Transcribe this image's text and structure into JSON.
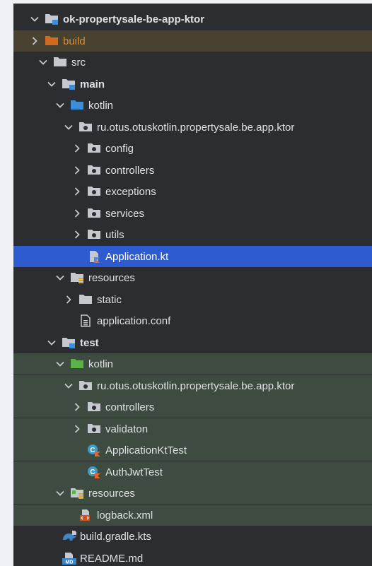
{
  "colors": {
    "panel_bg": "#2b2d30",
    "selection": "#2e5bd0",
    "excluded_bg": "#4a4230",
    "test_sources_bg": "#3d4b40",
    "folder_gray": "#c5c8ce",
    "folder_blue": "#3c8fd6",
    "folder_green": "#5bb246",
    "folder_orange": "#d06b1e",
    "excluded_text": "#d48f3c"
  },
  "tree": [
    {
      "label": "ok-propertysale-be-app-ktor",
      "icon": "module-folder-icon",
      "chevron": "down",
      "depth": 0,
      "bold": true
    },
    {
      "label": "build",
      "icon": "folder-excluded-icon",
      "chevron": "right",
      "depth": 0,
      "style": "excluded"
    },
    {
      "label": "src",
      "icon": "folder-icon",
      "chevron": "down",
      "depth": 1
    },
    {
      "label": "main",
      "icon": "module-folder-icon",
      "chevron": "down",
      "depth": 2,
      "bold": true
    },
    {
      "label": "kotlin",
      "icon": "folder-source-icon",
      "chevron": "down",
      "depth": 3
    },
    {
      "label": "ru.otus.otuskotlin.propertysale.be.app.ktor",
      "icon": "package-icon",
      "chevron": "down",
      "depth": 4
    },
    {
      "label": "config",
      "icon": "package-icon",
      "chevron": "right",
      "depth": 5
    },
    {
      "label": "controllers",
      "icon": "package-icon",
      "chevron": "right",
      "depth": 5
    },
    {
      "label": "exceptions",
      "icon": "package-icon",
      "chevron": "right",
      "depth": 5
    },
    {
      "label": "services",
      "icon": "package-icon",
      "chevron": "right",
      "depth": 5
    },
    {
      "label": "utils",
      "icon": "package-icon",
      "chevron": "right",
      "depth": 5
    },
    {
      "label": "Application.kt",
      "icon": "kotlin-file-icon",
      "chevron": "none",
      "depth": 5,
      "style": "selected"
    },
    {
      "label": "resources",
      "icon": "folder-resources-icon",
      "chevron": "down",
      "depth": 3
    },
    {
      "label": "static",
      "icon": "folder-icon",
      "chevron": "right",
      "depth": 4
    },
    {
      "label": "application.conf",
      "icon": "config-file-icon",
      "chevron": "none",
      "depth": 4
    },
    {
      "label": "test",
      "icon": "module-folder-icon",
      "chevron": "down",
      "depth": 2,
      "bold": true
    },
    {
      "label": "kotlin",
      "icon": "folder-test-icon",
      "chevron": "down",
      "depth": 3,
      "style": "testsrc"
    },
    {
      "label": "ru.otus.otuskotlin.propertysale.be.app.ktor",
      "icon": "package-icon",
      "chevron": "down",
      "depth": 4,
      "style": "testsrc"
    },
    {
      "label": "controllers",
      "icon": "package-icon",
      "chevron": "right",
      "depth": 5,
      "style": "testsrc"
    },
    {
      "label": "validaton",
      "icon": "package-icon",
      "chevron": "right",
      "depth": 5,
      "style": "testsrc"
    },
    {
      "label": "ApplicationKtTest",
      "icon": "kotlin-class-icon",
      "chevron": "none",
      "depth": 5,
      "style": "testsrc"
    },
    {
      "label": "AuthJwtTest",
      "icon": "kotlin-class-icon",
      "chevron": "none",
      "depth": 5,
      "style": "testsrc"
    },
    {
      "label": "resources",
      "icon": "folder-test-resources-icon",
      "chevron": "down",
      "depth": 3,
      "style": "testsrc"
    },
    {
      "label": "logback.xml",
      "icon": "xml-file-icon",
      "chevron": "none",
      "depth": 4,
      "style": "testsrc"
    },
    {
      "label": "build.gradle.kts",
      "icon": "gradle-file-icon",
      "chevron": "none",
      "depth": 2
    },
    {
      "label": "README.md",
      "icon": "markdown-file-icon",
      "chevron": "none",
      "depth": 2
    }
  ]
}
